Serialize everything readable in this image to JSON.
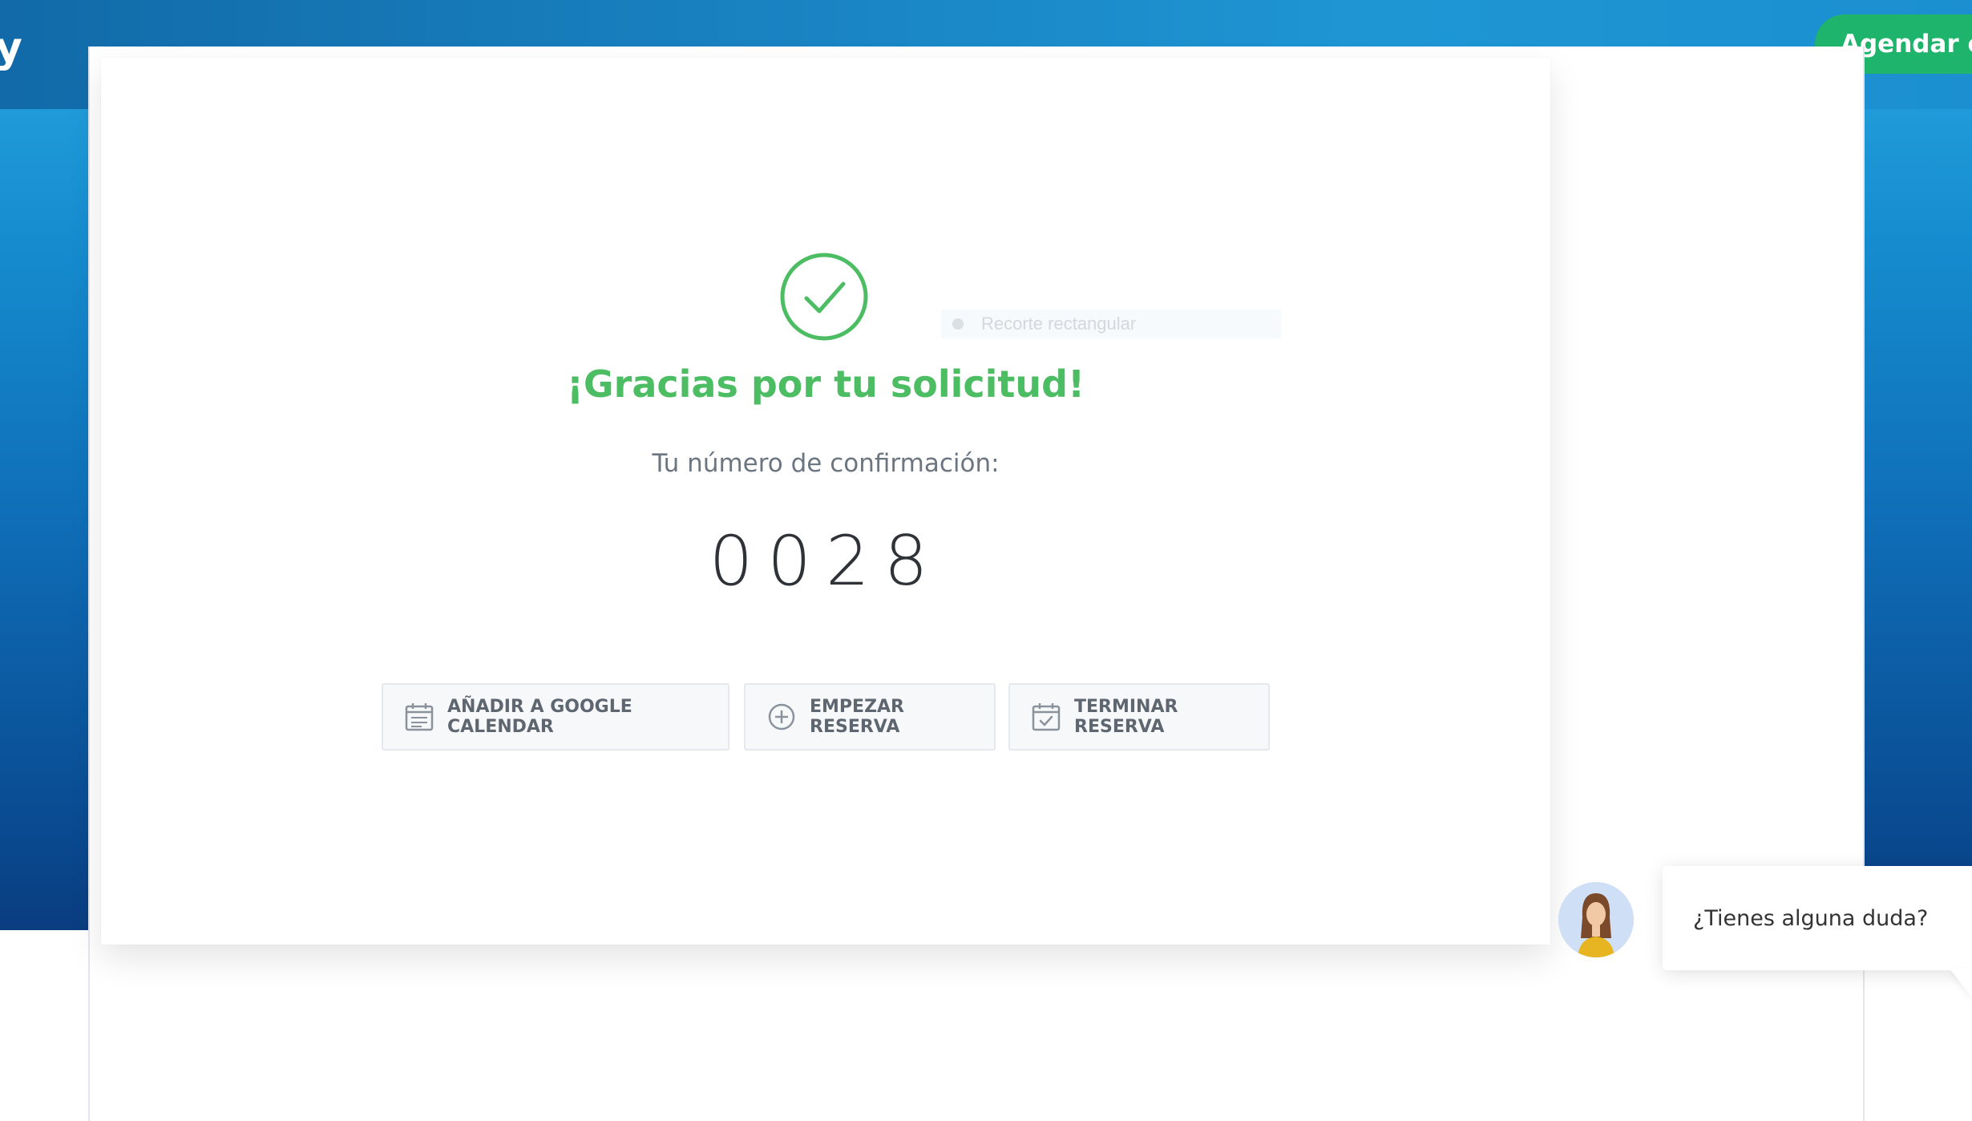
{
  "header": {
    "logo_fragment": "y",
    "cta_label": "Agendar ci"
  },
  "overlay": {
    "snip_tooltip": "Recorte rectangular"
  },
  "confirmation": {
    "title": "¡Gracias por tu solicitud!",
    "label": "Tu número de confirmación:",
    "number": "0028"
  },
  "actions": [
    {
      "label": "AÑADIR A GOOGLE CALENDAR",
      "icon": "calendar-icon"
    },
    {
      "label": "EMPEZAR RESERVA",
      "icon": "plus-circle-icon"
    },
    {
      "label": "TERMINAR RESERVA",
      "icon": "calendar-check-icon"
    }
  ],
  "chat": {
    "message": "¿Tienes alguna duda?",
    "avatar": "agent-avatar"
  },
  "colors": {
    "success": "#4dbd63",
    "cta": "#1fb46b",
    "hero_blue": "#0f6fb8"
  }
}
